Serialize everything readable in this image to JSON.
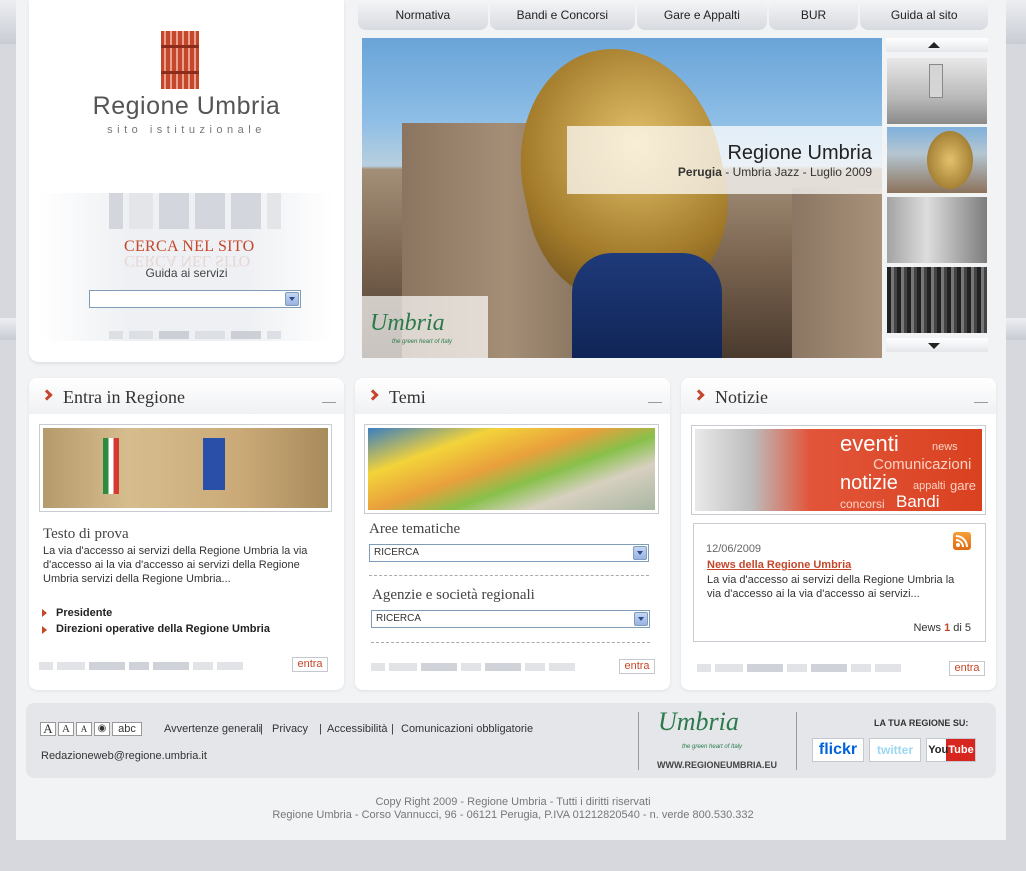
{
  "logo": {
    "title": "Regione Umbria",
    "subtitle": "sito istituzionale"
  },
  "search": {
    "title": "CERCA NEL SITO",
    "guide_label": "Guida ai servizi",
    "select_value": ""
  },
  "nav": {
    "items": [
      "Normativa",
      "Bandi e Concorsi",
      "Gare e Appalti",
      "BUR",
      "Guida al sito"
    ]
  },
  "hero": {
    "title": "Regione Umbria",
    "caption_place": "Perugia",
    "caption_sep1": " - ",
    "caption_event": "Umbria Jazz",
    "caption_sep2": " - ",
    "caption_date": "Luglio 2009",
    "logo_text": "Umbria",
    "logo_tag": "the green heart of Italy"
  },
  "panels": {
    "regione": {
      "title": "Entra in Regione",
      "heading": "Testo di prova",
      "text": "La via d'accesso ai servizi della Regione Umbria la via d'accesso ai la via d'accesso ai servizi della Regione Umbria servizi della Regione Umbria...",
      "links": [
        "Presidente",
        "Direzioni operative della Regione Umbria"
      ],
      "entra": "entra"
    },
    "temi": {
      "title": "Temi",
      "aree_label": "Aree tematiche",
      "aree_select": "RICERCA",
      "agenzie_label": "Agenzie e società regionali",
      "agenzie_select": "RICERCA",
      "entra": "entra"
    },
    "notizie": {
      "title": "Notizie",
      "banner_words": [
        "eventi",
        "news",
        "Comunicazioni",
        "notizie",
        "appalti",
        "gare",
        "concorsi",
        "Bandi"
      ],
      "date": "12/06/2009",
      "news_title": "News della Regione Umbria",
      "news_text": "La via d'accesso ai servizi della Regione Umbria la via d'accesso ai la via d'accesso ai servizi...",
      "pager_label": "News",
      "pager_current": "1",
      "pager_of": "di",
      "pager_total": "5",
      "entra": "entra"
    }
  },
  "footer": {
    "font_tools": [
      "A",
      "A",
      "A",
      "abc"
    ],
    "links": [
      "Avvertenze generali",
      "Privacy",
      "Accessibilità",
      "Comunicazioni obbligatorie"
    ],
    "separators": [
      "|",
      "|",
      "|"
    ],
    "email": "Redazioneweb@regione.umbria.it",
    "umbria_logo": "Umbria",
    "umbria_tag": "the green heart of Italy",
    "umbria_url": "WWW.REGIONEUMBRIA.EU",
    "social_title": "LA TUA REGIONE SU:",
    "social": [
      "flickr",
      "twitter",
      "YouTube"
    ]
  },
  "copyright": {
    "line1": "Copy Right 2009 - Regione Umbria - Tutti i diritti riservati",
    "line2": "Regione Umbria - Corso Vannucci, 96 - 06121 Perugia, P.IVA 01212820540 - n. verde 800.530.332"
  },
  "colors": {
    "accent": "#c4472b",
    "green": "#2a7a4a",
    "link_blue": "#2d4a8a"
  }
}
